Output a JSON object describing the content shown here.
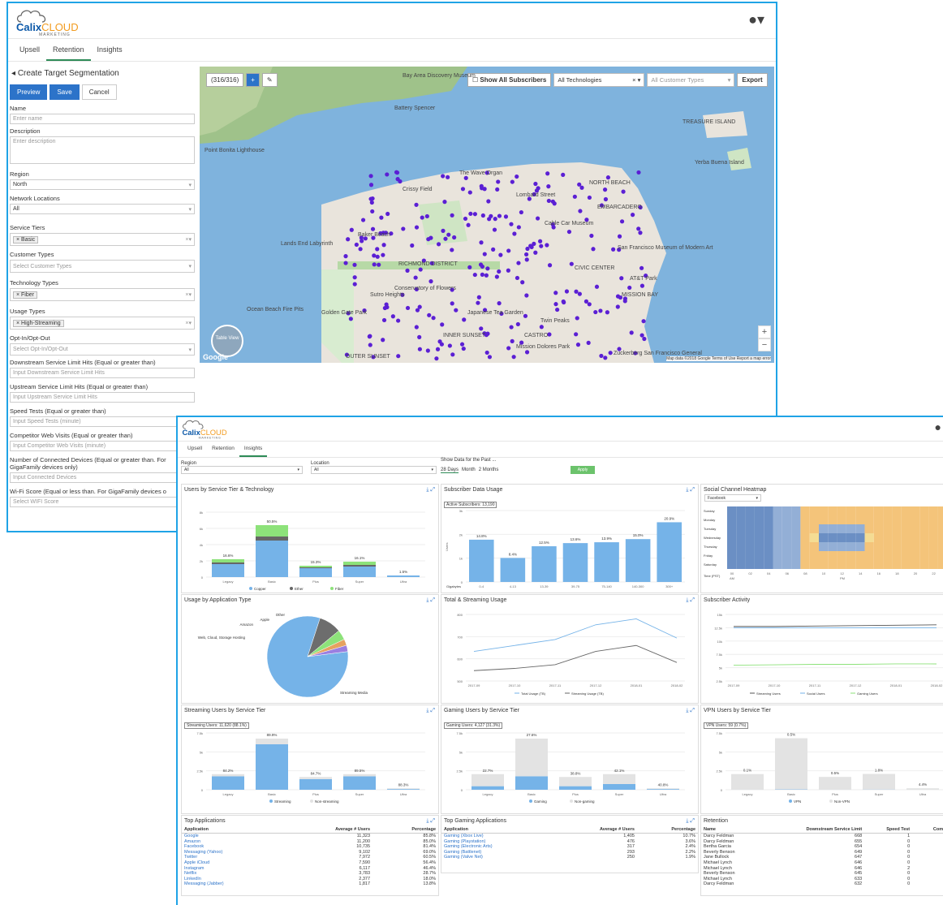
{
  "brand": {
    "name1": "Calix",
    "name2": "CLOUD",
    "sub": "MARKETING"
  },
  "colors": {
    "accent": "#2c73c9",
    "green": "#2e8b57",
    "bar": "#75b3e8",
    "grey": "#e0e0e0"
  },
  "w1": {
    "tabs": [
      "Upsell",
      "Retention",
      "Insights"
    ],
    "heading": "Create Target Segmentation",
    "buttons": {
      "preview": "Preview",
      "save": "Save",
      "cancel": "Cancel"
    },
    "fields": {
      "name": {
        "label": "Name",
        "placeholder": "Enter name"
      },
      "description": {
        "label": "Description",
        "placeholder": "Enter description"
      },
      "region": {
        "label": "Region",
        "value": "North"
      },
      "network": {
        "label": "Network Locations",
        "value": "All"
      },
      "tiers": {
        "label": "Service Tiers",
        "chip": "× Basic"
      },
      "customer": {
        "label": "Customer Types",
        "placeholder": "Select Customer Types"
      },
      "tech": {
        "label": "Technology Types",
        "chip": "× Fiber"
      },
      "usage": {
        "label": "Usage Types",
        "chip": "× High-Streaming"
      },
      "opt": {
        "label": "Opt-In/Opt-Out",
        "placeholder": "Select Opt-In/Opt-Out"
      },
      "down": {
        "label": "Downstream Service Limit Hits (Equal or greater than)",
        "placeholder": "Input Downstream Service Limit Hits"
      },
      "up": {
        "label": "Upstream Service Limit Hits (Equal or greater than)",
        "placeholder": "Input Upstream Service Limit Hits"
      },
      "speed": {
        "label": "Speed Tests (Equal or greater than)",
        "placeholder": "Input Speed Tests (minute)"
      },
      "comp": {
        "label": "Competitor Web Visits (Equal or greater than)",
        "placeholder": "Input Competitor Web Visits (minute)"
      },
      "devices": {
        "label": "Number of Connected Devices (Equal or greater than. For GigaFamily devices only)",
        "placeholder": "Input Connected Devices"
      },
      "wifi": {
        "label": "Wi-Fi Score (Equal or less than. For GigaFamily devices o",
        "placeholder": "Select WIFI Score"
      }
    },
    "map": {
      "count": "(316/316)",
      "plus": "+",
      "show_all": "Show All Subscribers",
      "tech": "All Technologies",
      "cust": "All Customer Types",
      "export": "Export",
      "labels": [
        "Bay Area Discovery Museum",
        "Battery Spencer",
        "Point Bonita Lighthouse",
        "The Wave Organ",
        "Crissy Field",
        "Lombard Street",
        "NORTH BEACH",
        "EMBARCADERO",
        "TREASURE ISLAND",
        "Yerba Buena Island",
        "Lands End Labyrinth",
        "Baker Beach",
        "Cable Car Museum",
        "San Francisco Museum of Modern Art",
        "AT&T Park",
        "Conservatory of Flowers",
        "Ocean Beach Fire Pits",
        "Golden Gate Park",
        "CIVIC CENTER",
        "Mission Dolores Park",
        "Zuckerberg San Francisco General",
        "MISSION BAY",
        "RICHMOND DISTRICT",
        "INNER SUNSET",
        "OUTER SUNSET",
        "Sutro Heights",
        "Japanese Tea Garden",
        "Twin Peaks",
        "CASTRO"
      ],
      "table_view": "Table View",
      "google": "Google",
      "footer": "Map data ©2018 Google  Terms of Use  Report a map error"
    }
  },
  "w2": {
    "tabs": [
      "Upsell",
      "Retention",
      "Insights"
    ],
    "filters": {
      "region_label": "Region",
      "region": "All",
      "location_label": "Location",
      "location": "All",
      "period_label": "Show Data for the Past ...",
      "periods": [
        "28 Days",
        "Month",
        "2 Months"
      ],
      "apply": "Apply"
    },
    "panels": {
      "p1": "Users by Service Tier & Technology",
      "p2": "Subscriber Data Usage",
      "p3": "Social Channel Heatmap",
      "p4": "Usage by Application Type",
      "p5": "Total & Streaming Usage",
      "p6": "Subscriber Activity",
      "p7": "Streaming Users by Service Tier",
      "p8": "Gaming Users by Service Tier",
      "p9": "VPN Users by Service Tier",
      "p10": "Top Applications",
      "p11": "Top Gaming Applications",
      "p12": "Retention"
    },
    "badges": {
      "p2": "Active Subscribers: 13,190",
      "p7": "Streaming Users: 11,620 (88.1%)",
      "p8": "Gaming Users: 4,127 (31.3%)",
      "p9": "VPN Users: 59 (0.7%)"
    },
    "heatmap_select": "Facebook",
    "top_apps": {
      "headers": [
        "Application",
        "Average # Users",
        "Percentage"
      ],
      "rows": [
        [
          "Google",
          "11,323",
          "85.8%"
        ],
        [
          "Amazon",
          "11,200",
          "85.0%"
        ],
        [
          "Facebook",
          "10,735",
          "81.4%"
        ],
        [
          "Messaging (Yahoo)",
          "9,102",
          "69.0%"
        ],
        [
          "Twitter",
          "7,972",
          "60.5%"
        ],
        [
          "Apple iCloud",
          "7,590",
          "56.4%"
        ],
        [
          "Instagram",
          "6,117",
          "46.4%"
        ],
        [
          "Netflix",
          "3,783",
          "28.7%"
        ],
        [
          "LinkedIn",
          "2,377",
          "18.0%"
        ],
        [
          "Messaging (Jabber)",
          "1,817",
          "13.8%"
        ]
      ]
    },
    "gaming_apps": {
      "headers": [
        "Application",
        "Average # Users",
        "Percentage"
      ],
      "rows": [
        [
          "Gaming (Xbox Live)",
          "1,405",
          "10.7%"
        ],
        [
          "Gaming (Playstation)",
          "476",
          "3.6%"
        ],
        [
          "Gaming (Electronic Arts)",
          "317",
          "2.4%"
        ],
        [
          "Gaming (Battlenet)",
          "293",
          "2.2%"
        ],
        [
          "Gaming (Valve Net)",
          "250",
          "1.9%"
        ]
      ]
    },
    "retention": {
      "headers": [
        "Name",
        "Downstream Service Limit",
        "Speed Test",
        "Compet Vi"
      ],
      "rows": [
        [
          "Darcy Feldman",
          "668",
          "1"
        ],
        [
          "Darcy Feldman",
          "655",
          "0"
        ],
        [
          "Bertha Garcia",
          "654",
          "0"
        ],
        [
          "Beverly Benson",
          "649",
          "0"
        ],
        [
          "Jane Bullock",
          "647",
          "0"
        ],
        [
          "Michael Lynch",
          "646",
          "0"
        ],
        [
          "Michael Lynch",
          "646",
          "2"
        ],
        [
          "Beverly Benson",
          "645",
          "0"
        ],
        [
          "Michael Lynch",
          "633",
          "0"
        ],
        [
          "Darcy Feldman",
          "632",
          "0"
        ]
      ]
    }
  },
  "chart_data": [
    {
      "type": "bar",
      "title": "Users by Service Tier & Technology",
      "categories": [
        "Legacy",
        "Basic",
        "Plus",
        "Super",
        "Ultra"
      ],
      "series": [
        {
          "name": "Copper",
          "values": [
            1.6,
            4.5,
            1.1,
            1.3,
            0.2
          ]
        },
        {
          "name": "Ether",
          "values": [
            0.2,
            0.5,
            0.1,
            0.2,
            0
          ]
        },
        {
          "name": "Fiber",
          "values": [
            0.4,
            1.4,
            0.2,
            0.4,
            0
          ]
        }
      ],
      "data_labels": [
        "16.6%",
        "50.5%",
        "15.3%",
        "16.1%",
        "1.5%"
      ],
      "yticks": [
        "0",
        "2k",
        "4k",
        "6k",
        "8k"
      ],
      "ylim": [
        0,
        8
      ]
    },
    {
      "type": "bar",
      "title": "Subscriber Data Usage",
      "categories": [
        "0-4",
        "4-13",
        "13-39",
        "39-75",
        "75-140",
        "140-300",
        "300+"
      ],
      "values": [
        14.8,
        8.4,
        12.5,
        13.6,
        13.9,
        15.0,
        20.9
      ],
      "data_labels": [
        "14.8%",
        "8.4%",
        "12.5%",
        "13.6%",
        "13.9%",
        "15.0%",
        "20.9%"
      ],
      "yticks": [
        "0",
        "1k",
        "2k",
        "3k"
      ],
      "ylabel": "Users",
      "xlabel": "Gigabytes"
    },
    {
      "type": "heatmap",
      "title": "Social Channel Heatmap",
      "rows": [
        "Sunday",
        "Monday",
        "Tuesday",
        "Wednesday",
        "Thursday",
        "Friday",
        "Saturday"
      ],
      "xlabel": "Time (PST)",
      "xticks": [
        "00",
        "02",
        "04",
        "06",
        "08",
        "10",
        "12",
        "14",
        "16",
        "18",
        "20",
        "22"
      ],
      "xsub": [
        "AM",
        "PM"
      ]
    },
    {
      "type": "pie",
      "title": "Usage by Application Type",
      "slices": [
        {
          "name": "Streaming Media",
          "value": 82
        },
        {
          "name": "Web, Cloud, Storage Hosting",
          "value": 9
        },
        {
          "name": "Amazon",
          "value": 4
        },
        {
          "name": "Apple",
          "value": 2.5
        },
        {
          "name": "Other",
          "value": 2.5
        }
      ]
    },
    {
      "type": "line",
      "title": "Total & Streaming Usage",
      "x": [
        "2017-09",
        "2017-10",
        "2017-11",
        "2017-12",
        "2018-01",
        "2018-02"
      ],
      "series": [
        {
          "name": "Total Usage (TB)",
          "values": [
            650,
            690,
            730,
            830,
            870,
            740
          ]
        },
        {
          "name": "Streaming Usage (TB)",
          "values": [
            520,
            535,
            560,
            650,
            690,
            575
          ]
        }
      ],
      "yticks": [
        "500",
        "600",
        "700",
        "800"
      ]
    },
    {
      "type": "line",
      "title": "Subscriber Activity",
      "x": [
        "2017-09",
        "2017-10",
        "2017-11",
        "2017-12",
        "2018-01",
        "2018-02"
      ],
      "series": [
        {
          "name": "Streaming Users",
          "values": [
            13.1,
            13.1,
            13.2,
            13.3,
            13.4,
            13.5
          ]
        },
        {
          "name": "Social Users",
          "values": [
            12.8,
            12.8,
            12.8,
            12.8,
            12.8,
            12.8
          ]
        },
        {
          "name": "Gaming Users",
          "values": [
            3.8,
            3.9,
            4.0,
            4.0,
            4.1,
            4.1
          ]
        }
      ],
      "yticks": [
        "2.5k",
        "5k",
        "7.5k",
        "10k",
        "12.5k",
        "15k"
      ]
    },
    {
      "type": "bar",
      "title": "Streaming Users by Service Tier",
      "categories": [
        "Legacy",
        "Basic",
        "Plus",
        "Super",
        "Ultra"
      ],
      "series": [
        {
          "name": "Streaming",
          "values": [
            1.9,
            6.4,
            1.5,
            1.9,
            0.1
          ]
        },
        {
          "name": "Non-streaming",
          "values": [
            0.3,
            0.8,
            0.3,
            0.3,
            0.1
          ]
        }
      ],
      "data_labels": [
        "84.2%",
        "89.9%",
        "84.7%",
        "89.5%",
        "88.3%"
      ],
      "yticks": [
        "0",
        "2.5k",
        "5k",
        "7.5k"
      ]
    },
    {
      "type": "bar",
      "title": "Gaming Users by Service Tier",
      "categories": [
        "Legacy",
        "Basic",
        "Plus",
        "Super",
        "Ultra"
      ],
      "series": [
        {
          "name": "Gaming",
          "values": [
            0.5,
            1.9,
            0.5,
            0.8,
            0.1
          ]
        },
        {
          "name": "Non-gaming",
          "values": [
            1.7,
            5.3,
            1.3,
            1.4,
            0.1
          ]
        }
      ],
      "data_labels": [
        "22.7%",
        "27.6%",
        "38.8%",
        "42.1%",
        "40.8%"
      ],
      "yticks": [
        "0",
        "2.5k",
        "5k",
        "7.5k"
      ]
    },
    {
      "type": "bar",
      "title": "VPN Users by Service Tier",
      "categories": [
        "Legacy",
        "Basic",
        "Plus",
        "Super",
        "Ultra"
      ],
      "series": [
        {
          "name": "VPN",
          "values": [
            0.01,
            0.05,
            0.01,
            0.03,
            0.01
          ]
        },
        {
          "name": "Non-VPN",
          "values": [
            2.2,
            7.2,
            1.8,
            2.2,
            0.2
          ]
        }
      ],
      "data_labels": [
        "0.1%",
        "0.5%",
        "0.5%",
        "1.8%",
        "4.4%"
      ],
      "yticks": [
        "0",
        "2.5k",
        "5k",
        "7.5k"
      ]
    }
  ]
}
